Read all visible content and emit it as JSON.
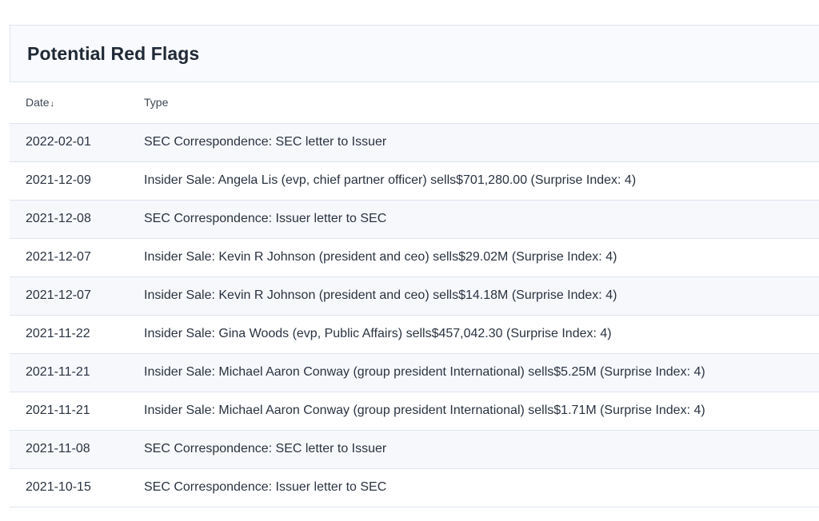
{
  "panel": {
    "title": "Potential Red Flags"
  },
  "table": {
    "columns": [
      {
        "label": "Date",
        "sort_icon": "arrow-down-icon"
      },
      {
        "label": "Type"
      }
    ],
    "sort_arrow": "↓",
    "rows": [
      {
        "date": "2022-02-01",
        "type": "SEC Correspondence: SEC letter to Issuer"
      },
      {
        "date": "2021-12-09",
        "type": "Insider Sale: Angela Lis (evp, chief partner officer) sells$701,280.00 (Surprise Index: 4)"
      },
      {
        "date": "2021-12-08",
        "type": "SEC Correspondence: Issuer letter to SEC"
      },
      {
        "date": "2021-12-07",
        "type": "Insider Sale: Kevin R Johnson (president and ceo) sells$29.02M (Surprise Index: 4)"
      },
      {
        "date": "2021-12-07",
        "type": "Insider Sale: Kevin R Johnson (president and ceo) sells$14.18M (Surprise Index: 4)"
      },
      {
        "date": "2021-11-22",
        "type": "Insider Sale: Gina Woods (evp, Public Affairs) sells$457,042.30 (Surprise Index: 4)"
      },
      {
        "date": "2021-11-21",
        "type": "Insider Sale: Michael Aaron Conway (group president International) sells$5.25M (Surprise Index: 4)"
      },
      {
        "date": "2021-11-21",
        "type": "Insider Sale: Michael Aaron Conway (group president International) sells$1.71M (Surprise Index: 4)"
      },
      {
        "date": "2021-11-08",
        "type": "SEC Correspondence: SEC letter to Issuer"
      },
      {
        "date": "2021-10-15",
        "type": "SEC Correspondence: Issuer letter to SEC"
      }
    ]
  }
}
